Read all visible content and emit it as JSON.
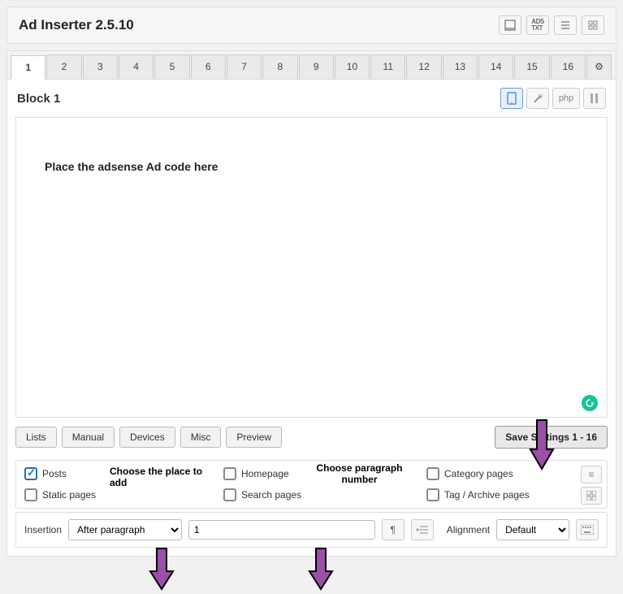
{
  "header": {
    "title": "Ad Inserter 2.5.10"
  },
  "tabs": [
    "1",
    "2",
    "3",
    "4",
    "5",
    "6",
    "7",
    "8",
    "9",
    "10",
    "11",
    "12",
    "13",
    "14",
    "15",
    "16"
  ],
  "block": {
    "title": "Block 1",
    "php": "php"
  },
  "code": {
    "placeholder_text": "Place the adsense Ad code here"
  },
  "buttons": {
    "lists": "Lists",
    "manual": "Manual",
    "devices": "Devices",
    "misc": "Misc",
    "preview": "Preview",
    "save": "Save Settings 1 - 16"
  },
  "checks": {
    "posts": "Posts",
    "static": "Static pages",
    "home": "Homepage",
    "search": "Search pages",
    "category": "Category pages",
    "archive": "Tag / Archive pages"
  },
  "annotations": {
    "place": "Choose the place to add",
    "paragraph": "Choose paragraph number"
  },
  "insertion": {
    "label": "Insertion",
    "option": "After paragraph",
    "value": "1",
    "align_label": "Alignment",
    "align_option": "Default"
  }
}
